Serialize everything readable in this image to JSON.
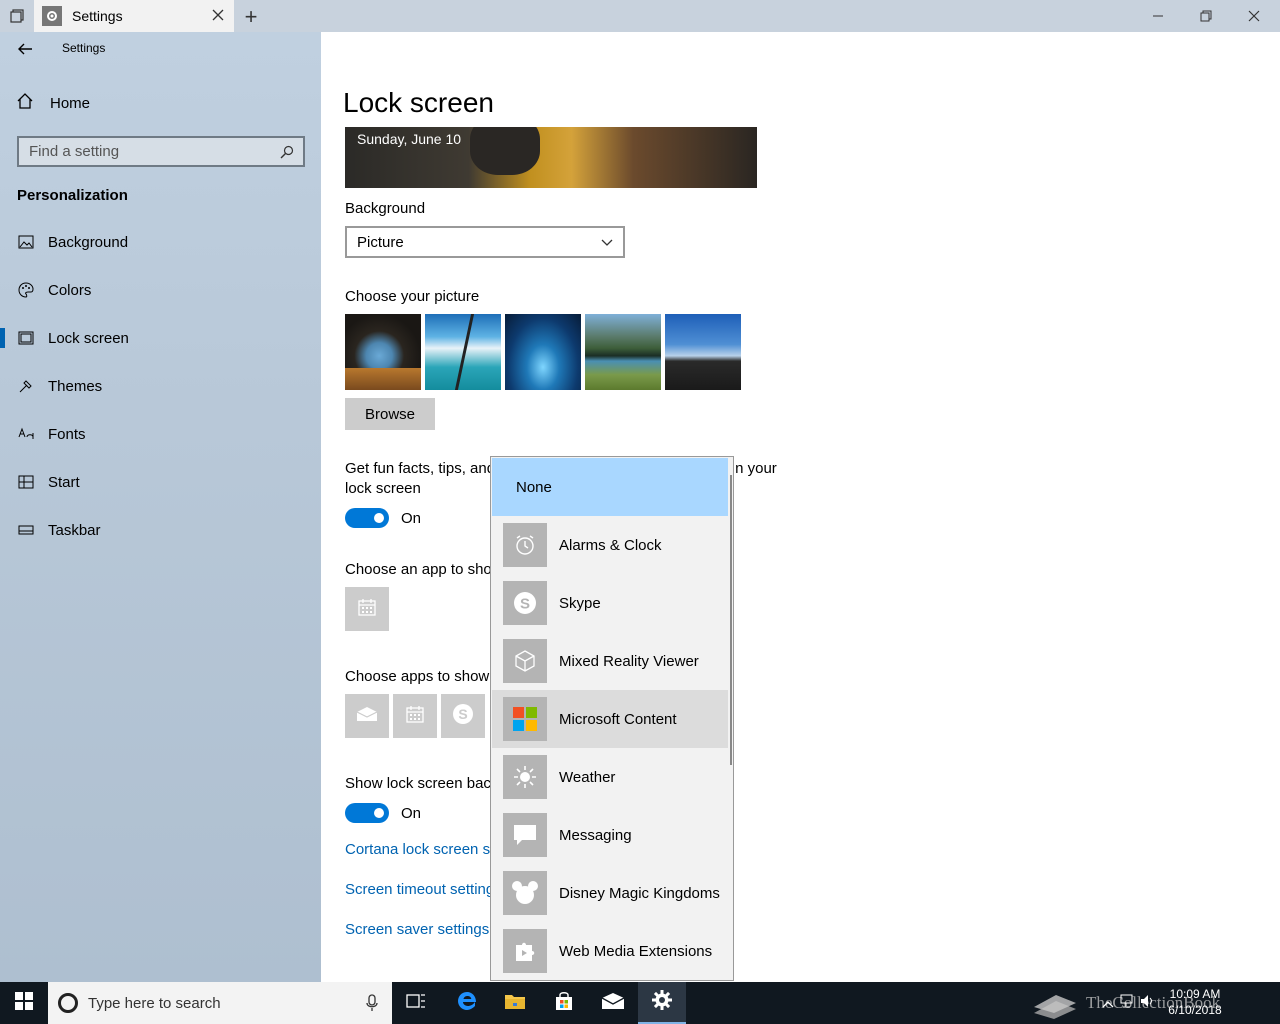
{
  "window": {
    "tab_title": "Settings",
    "new_tab": "+"
  },
  "sidebar": {
    "title": "Settings",
    "home": "Home",
    "search_placeholder": "Find a setting",
    "section": "Personalization",
    "items": [
      {
        "label": "Background",
        "icon": "picture-icon"
      },
      {
        "label": "Colors",
        "icon": "palette-icon"
      },
      {
        "label": "Lock screen",
        "icon": "lock-screen-icon"
      },
      {
        "label": "Themes",
        "icon": "themes-icon"
      },
      {
        "label": "Fonts",
        "icon": "fonts-icon"
      },
      {
        "label": "Start",
        "icon": "start-icon"
      },
      {
        "label": "Taskbar",
        "icon": "taskbar-icon"
      }
    ]
  },
  "main": {
    "title": "Lock screen",
    "preview_date": "Sunday, June 10",
    "background_label": "Background",
    "background_value": "Picture",
    "choose_picture_label": "Choose your picture",
    "browse_label": "Browse",
    "fun_facts_line1": "Get fun facts, tips, and",
    "fun_facts_tail": "n your",
    "fun_facts_line2": "lock screen",
    "toggle1_state": "On",
    "choose_app_label": "Choose an app to sho",
    "choose_apps_label": "Choose apps to show",
    "show_bg_label": "Show lock screen back",
    "toggle2_state": "On",
    "links": [
      "Cortana lock screen se",
      "Screen timeout setting",
      "Screen saver settings"
    ]
  },
  "popup": {
    "items": [
      {
        "label": "None",
        "icon": ""
      },
      {
        "label": "Alarms & Clock",
        "icon": "alarm-clock-icon"
      },
      {
        "label": "Skype",
        "icon": "skype-icon"
      },
      {
        "label": "Mixed Reality Viewer",
        "icon": "cube-icon"
      },
      {
        "label": "Microsoft Content",
        "icon": "microsoft-logo-icon"
      },
      {
        "label": "Weather",
        "icon": "sun-icon"
      },
      {
        "label": "Messaging",
        "icon": "chat-bubble-icon"
      },
      {
        "label": "Disney Magic Kingdoms",
        "icon": "mickey-icon"
      },
      {
        "label": "Web Media Extensions",
        "icon": "puzzle-icon"
      }
    ],
    "selected": "None",
    "hovered": "Microsoft Content"
  },
  "taskbar": {
    "search_placeholder": "Type here to search",
    "time": "10:09 AM",
    "date": "6/10/2018",
    "watermark": "TheCollectionBook"
  },
  "colors": {
    "accent": "#0078d7",
    "link": "#0063b1",
    "selected_item": "#a9d7ff"
  }
}
